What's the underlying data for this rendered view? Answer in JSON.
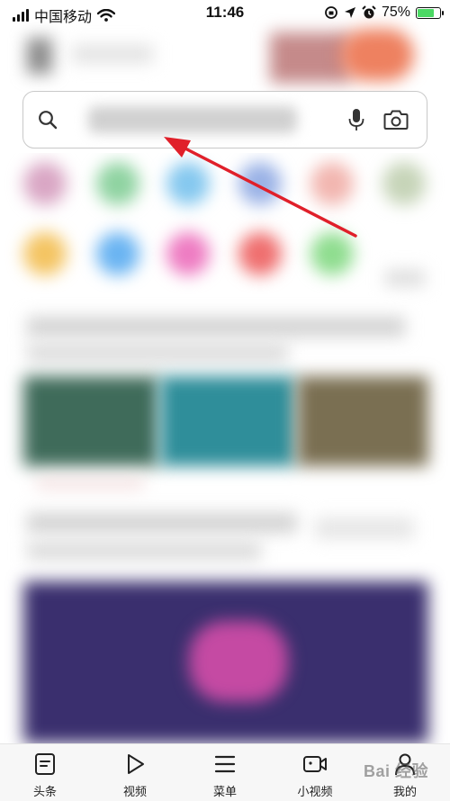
{
  "status_bar": {
    "carrier": "中国移动",
    "time": "11:46",
    "battery_percent": "75%",
    "battery_level": 0.75,
    "colors": {
      "battery_fill": "#4cd964"
    }
  },
  "search": {
    "icons": [
      "search-icon",
      "mic-icon",
      "camera-icon"
    ]
  },
  "annotation": {
    "color": "#e0202a"
  },
  "bottom_nav": {
    "items": [
      {
        "label": "头条",
        "icon": "document-icon"
      },
      {
        "label": "视频",
        "icon": "play-icon"
      },
      {
        "label": "菜单",
        "icon": "menu-icon"
      },
      {
        "label": "小视频",
        "icon": "video-camera-icon"
      },
      {
        "label": "我的",
        "icon": "person-icon"
      }
    ]
  },
  "watermark": {
    "text": "Bai 经验"
  }
}
